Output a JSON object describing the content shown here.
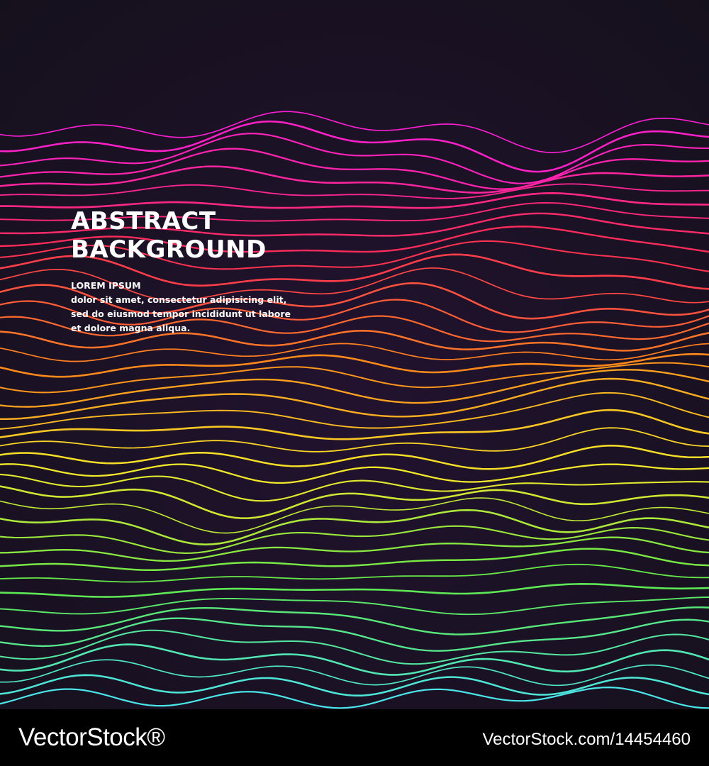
{
  "poster": {
    "title_line_1": "ABSTRACT",
    "title_line_2": "BACKGROUND",
    "subtitle": "LOREM IPSUM",
    "body": "dolor sit amet, consectetur adipisicing elit, sed do eiusmod tempor incididunt ut labore et dolore magna aliqua."
  },
  "footer": {
    "brand": "VectorStock®",
    "url": "VectorStock.com/14454460"
  },
  "colors": {
    "background": "#17111f",
    "line_top": "#ff1fd6",
    "line_upper": "#ff2d55",
    "line_middle": "#ff8a1a",
    "line_lower": "#f6e92a",
    "line_green": "#5fe84a",
    "line_bottom": "#4be6ea",
    "footer": "#000000",
    "text": "#ffffff"
  }
}
